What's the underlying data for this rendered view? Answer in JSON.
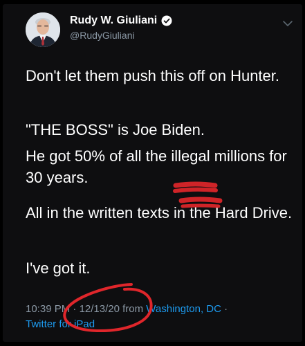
{
  "tweet": {
    "author": {
      "display_name": "Rudy W. Giuliani",
      "handle": "@RudyGiuliani",
      "verified": true,
      "avatar_icon": "profile-photo"
    },
    "menu_icon": "chevron-down-icon",
    "paragraphs": [
      "Don't let them push this off on Hunter.",
      "\"THE BOSS\" is Joe Biden.",
      "He got 50% of all the illegal millions for 30 years.",
      "All in the written texts in the Hard Drive.",
      "I've got it."
    ],
    "meta": {
      "time": "10:39 PM",
      "separator": "·",
      "date": "12/13/20",
      "from_word": "from",
      "location": "Washington, DC",
      "source": "Twitter for iPad"
    }
  },
  "annotations": {
    "highlight_color": "#e0262b",
    "marks": [
      "scribble-mark",
      "date-circle"
    ]
  },
  "colors": {
    "background": "#000000",
    "card": "#0e0e10",
    "text": "#ffffff",
    "secondary_text": "#8b98a5",
    "link": "#1d9bf0",
    "verified": "#1d9bf0"
  }
}
